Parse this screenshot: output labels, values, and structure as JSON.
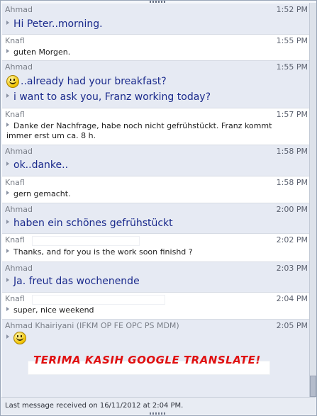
{
  "messages": [
    {
      "sender": "Ahmad",
      "time": "1:52 PM",
      "lines": [
        "Hi Peter..morning."
      ]
    },
    {
      "sender": "Knafl",
      "time": "1:55 PM",
      "lines": [
        "guten Morgen."
      ]
    },
    {
      "sender": "Ahmad",
      "time": "1:55 PM",
      "lines": [
        "..already had your breakfast?",
        "i want to ask you, Franz working today?"
      ]
    },
    {
      "sender": "Knafl",
      "time": "1:57 PM",
      "lines": [
        "Danke der Nachfrage, habe noch nicht gefrühstückt. Franz kommt immer erst um ca. 8 h."
      ]
    },
    {
      "sender": "Ahmad",
      "time": "1:58 PM",
      "lines": [
        "ok..danke.."
      ]
    },
    {
      "sender": "Knafl",
      "time": "1:58 PM",
      "lines": [
        "gern gemacht."
      ]
    },
    {
      "sender": "Ahmad",
      "time": "2:00 PM",
      "lines": [
        "haben ein schönes gefrühstückt"
      ]
    },
    {
      "sender": "Knafl",
      "time": "2:02 PM",
      "lines": [
        "Thanks,  and for you is the work soon finishd ?"
      ]
    },
    {
      "sender": "Ahmad",
      "time": "2:03 PM",
      "lines": [
        "Ja. freut das wochenende"
      ]
    },
    {
      "sender": "Knafl",
      "time": "2:04 PM",
      "lines": [
        "super, nice weekend"
      ]
    },
    {
      "sender": "Ahmad Khairiyani (IFKM OP FE OPC PS MDM)",
      "time": "2:05 PM",
      "lines": []
    }
  ],
  "overlay_text": "TERIMA KASIH GOOGLE TRANSLATE!",
  "status_text": "Last message received on 16/11/2012 at 2:04 PM.",
  "icons": {
    "smiley": "smiley-emoticon-icon",
    "bullet": "message-bullet-icon"
  },
  "colors": {
    "my_bubble": "#e6eaf3",
    "their_bubble": "#ffffff",
    "my_text": "#1a2a8c",
    "overlay": "#e01010"
  }
}
